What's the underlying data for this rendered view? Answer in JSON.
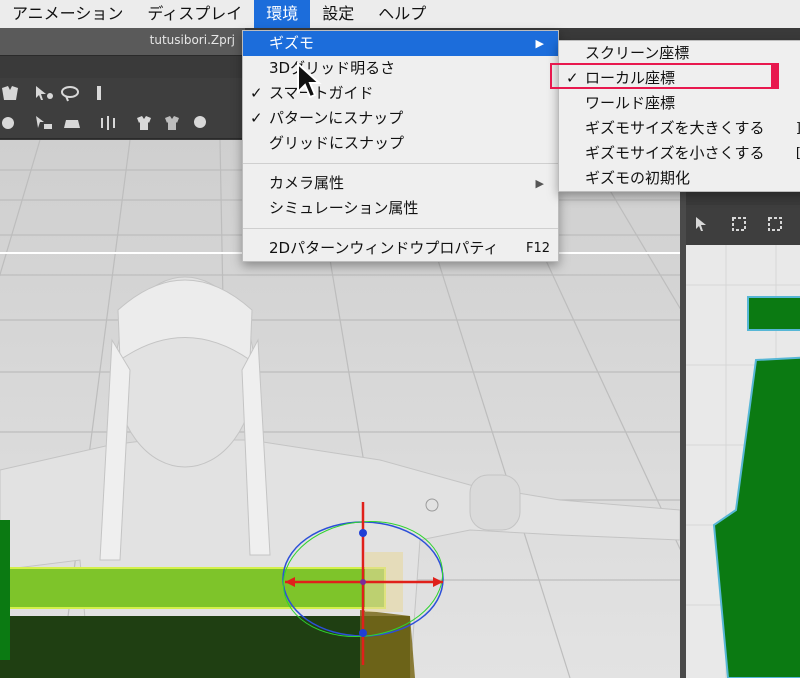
{
  "menubar": {
    "items": [
      "アニメーション",
      "ディスプレイ",
      "環境",
      "設定",
      "ヘルプ"
    ],
    "active_index": 2
  },
  "window": {
    "file_title": "tutusibori.Zprj"
  },
  "environment_menu": {
    "items": [
      {
        "label": "ギズモ",
        "checked": false,
        "submenu": true,
        "highlighted": true
      },
      {
        "label": "3Dグリッド明るさ",
        "checked": false
      },
      {
        "label": "スマートガイド",
        "checked": true
      },
      {
        "label": "パターンにスナップ",
        "checked": true
      },
      {
        "label": "グリッドにスナップ",
        "checked": false
      },
      {
        "label": "カメラ属性",
        "checked": false,
        "submenu": true
      },
      {
        "label": "シミュレーション属性",
        "checked": false
      },
      {
        "label": "2Dパターンウィンドウプロパティ",
        "checked": false,
        "shortcut": "F12"
      }
    ],
    "check_glyph": "✓",
    "arrow_glyph": "▶"
  },
  "gizmo_submenu": {
    "items": [
      {
        "label": "スクリーン座標",
        "checked": false
      },
      {
        "label": "ローカル座標",
        "checked": true,
        "callout": true
      },
      {
        "label": "ワールド座標",
        "checked": false
      },
      {
        "label": "ギズモサイズを大きくする",
        "checked": false,
        "shortcut": "]"
      },
      {
        "label": "ギズモサイズを小さくする",
        "checked": false,
        "shortcut": "["
      },
      {
        "label": "ギズモの初期化",
        "checked": false
      }
    ]
  },
  "colors": {
    "menu_highlight": "#1c6ddb",
    "callout_border": "#e8184e",
    "pattern_green": "#0b7a12",
    "pattern_outline": "#57b7d6",
    "gizmo_red": "#e0201a",
    "gizmo_blue": "#1f3fd6",
    "gizmo_green": "#2fd32f"
  },
  "icons": [
    "select-icon",
    "transform-icon",
    "lasso-icon",
    "pin-icon",
    "garment-icon",
    "fold-icon",
    "cursor-icon"
  ]
}
